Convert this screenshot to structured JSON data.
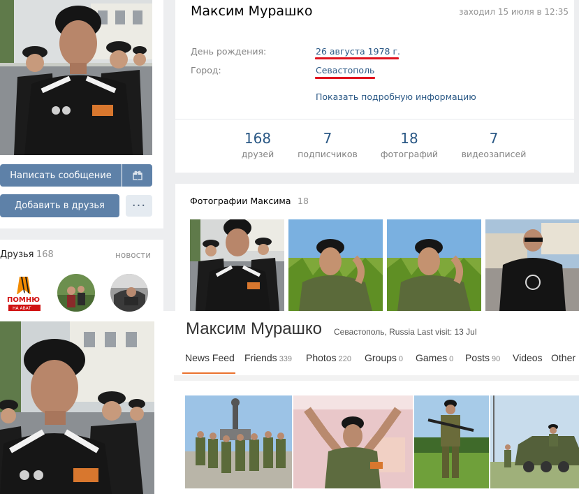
{
  "vk": {
    "name": "Максим Мурашко",
    "last_seen": "заходил 15 июля в 12:35",
    "birthday_label": "День рождения:",
    "birthday_value": "26 августа 1978 г.",
    "city_label": "Город:",
    "city_value": "Севастополь",
    "details_link": "Показать подробную информацию",
    "buttons": {
      "message": "Написать сообщение",
      "add_friend": "Добавить в друзья",
      "more": "···"
    },
    "counters": [
      {
        "value": "168",
        "label": "друзей"
      },
      {
        "value": "7",
        "label": "подписчиков"
      },
      {
        "value": "18",
        "label": "фотографий"
      },
      {
        "value": "7",
        "label": "видеозаписей"
      }
    ],
    "friends": {
      "title": "Друзья",
      "count": "168",
      "news_link": "новости",
      "badge_text": "ПОМНЮ",
      "badge_sub": "НА АВАТ"
    },
    "photos": {
      "title": "Фотографии Максима",
      "count": "18"
    }
  },
  "ok": {
    "name": "Максим Мурашко",
    "meta": "Севастополь, Russia  Last visit: 13 Jul",
    "tabs": [
      {
        "label": "News Feed",
        "count": ""
      },
      {
        "label": "Friends",
        "count": "339"
      },
      {
        "label": "Photos",
        "count": "220"
      },
      {
        "label": "Groups",
        "count": "0"
      },
      {
        "label": "Games",
        "count": "0"
      },
      {
        "label": "Posts",
        "count": "90"
      },
      {
        "label": "Videos",
        "count": ""
      },
      {
        "label": "Other",
        "count": ""
      }
    ],
    "active_tab": "News Feed"
  },
  "colors": {
    "link": "#2a5885",
    "button": "#5e81a8",
    "underline_red": "#e0141f",
    "ok_orange": "#eb722e",
    "vk_bg": "#edeef0"
  }
}
